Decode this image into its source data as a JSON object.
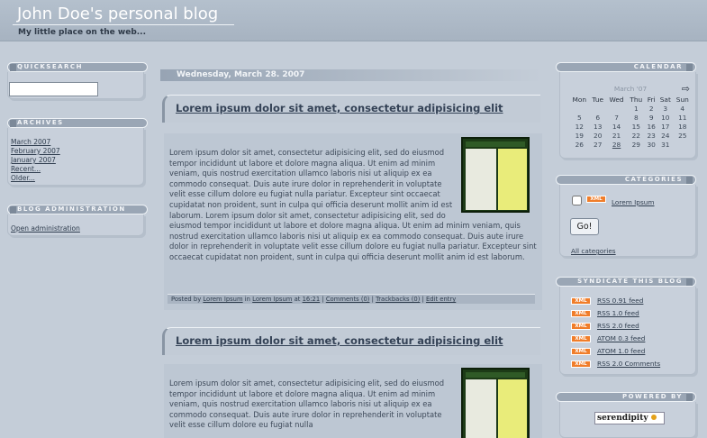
{
  "header": {
    "title": "John Doe's personal blog",
    "subtitle": "My little place on the web..."
  },
  "sidebar_left": {
    "quicksearch": {
      "title": "QUICKSEARCH",
      "value": ""
    },
    "archives": {
      "title": "ARCHIVES",
      "links": [
        "March 2007",
        "February 2007",
        "January 2007",
        "Recent...",
        "Older..."
      ]
    },
    "admin": {
      "title": "BLOG ADMINISTRATION",
      "link": "Open administration"
    }
  },
  "main": {
    "date": "Wednesday, March 28. 2007",
    "entries": [
      {
        "title": "Lorem ipsum dolor sit amet, consectetur adipisicing elit",
        "body": "Lorem ipsum dolor sit amet, consectetur adipisicing elit, sed do eiusmod tempor incididunt ut labore et dolore magna aliqua. Ut enim ad minim veniam, quis nostrud exercitation ullamco laboris nisi ut aliquip ex ea commodo consequat. Duis aute irure dolor in reprehenderit in voluptate velit esse cillum dolore eu fugiat nulla pariatur. Excepteur sint occaecat cupidatat non proident, sunt in culpa qui officia deserunt mollit anim id est laborum. Lorem ipsum dolor sit amet, consectetur adipisicing elit, sed do eiusmod tempor incididunt ut labore et dolore magna aliqua. Ut enim ad minim veniam, quis nostrud exercitation ullamco laboris nisi ut aliquip ex ea commodo consequat. Duis aute irure dolor in reprehenderit in voluptate velit esse cillum dolore eu fugiat nulla pariatur. Excepteur sint occaecat cupidatat non proident, sunt in culpa qui officia deserunt mollit anim id est laborum.",
        "footer": {
          "posted_by": "Posted by",
          "author": "Lorem Ipsum",
          "in": "in",
          "category": "Lorem Ipsum",
          "at": "at",
          "time": "16:21",
          "comments": "Comments (0)",
          "trackbacks": "Trackbacks (0)",
          "edit": "Edit entry"
        }
      },
      {
        "title": "Lorem ipsum dolor sit amet, consectetur adipisicing elit",
        "body": "Lorem ipsum dolor sit amet, consectetur adipisicing elit, sed do eiusmod tempor incididunt ut labore et dolore magna aliqua. Ut enim ad minim veniam, quis nostrud exercitation ullamco laboris nisi ut aliquip ex ea commodo consequat. Duis aute irure dolor in reprehenderit in voluptate velit esse cillum dolore eu fugiat nulla"
      }
    ]
  },
  "sidebar_right": {
    "calendar": {
      "title": "CALENDAR",
      "month": "March '07",
      "days": [
        "Mon",
        "Tue",
        "Wed",
        "Thu",
        "Fri",
        "Sat",
        "Sun"
      ],
      "weeks": [
        [
          "",
          "",
          "",
          "1",
          "2",
          "3",
          "4"
        ],
        [
          "5",
          "6",
          "7",
          "8",
          "9",
          "10",
          "11"
        ],
        [
          "12",
          "13",
          "14",
          "15",
          "16",
          "17",
          "18"
        ],
        [
          "19",
          "20",
          "21",
          "22",
          "23",
          "24",
          "25"
        ],
        [
          "26",
          "27",
          "28",
          "29",
          "30",
          "31",
          ""
        ]
      ]
    },
    "categories": {
      "title": "CATEGORIES",
      "item": "Lorem Ipsum",
      "go": "Go!",
      "all": "All categories",
      "badge": "XML"
    },
    "syndicate": {
      "title": "SYNDICATE THIS BLOG",
      "badge": "XML",
      "feeds": [
        "RSS 0.91 feed",
        "RSS 1.0 feed",
        "RSS 2.0 feed",
        "ATOM 0.3 feed",
        "ATOM 1.0 feed",
        "RSS 2.0 Comments"
      ]
    },
    "powered": {
      "title": "POWERED BY",
      "logo": "serendipity"
    }
  }
}
